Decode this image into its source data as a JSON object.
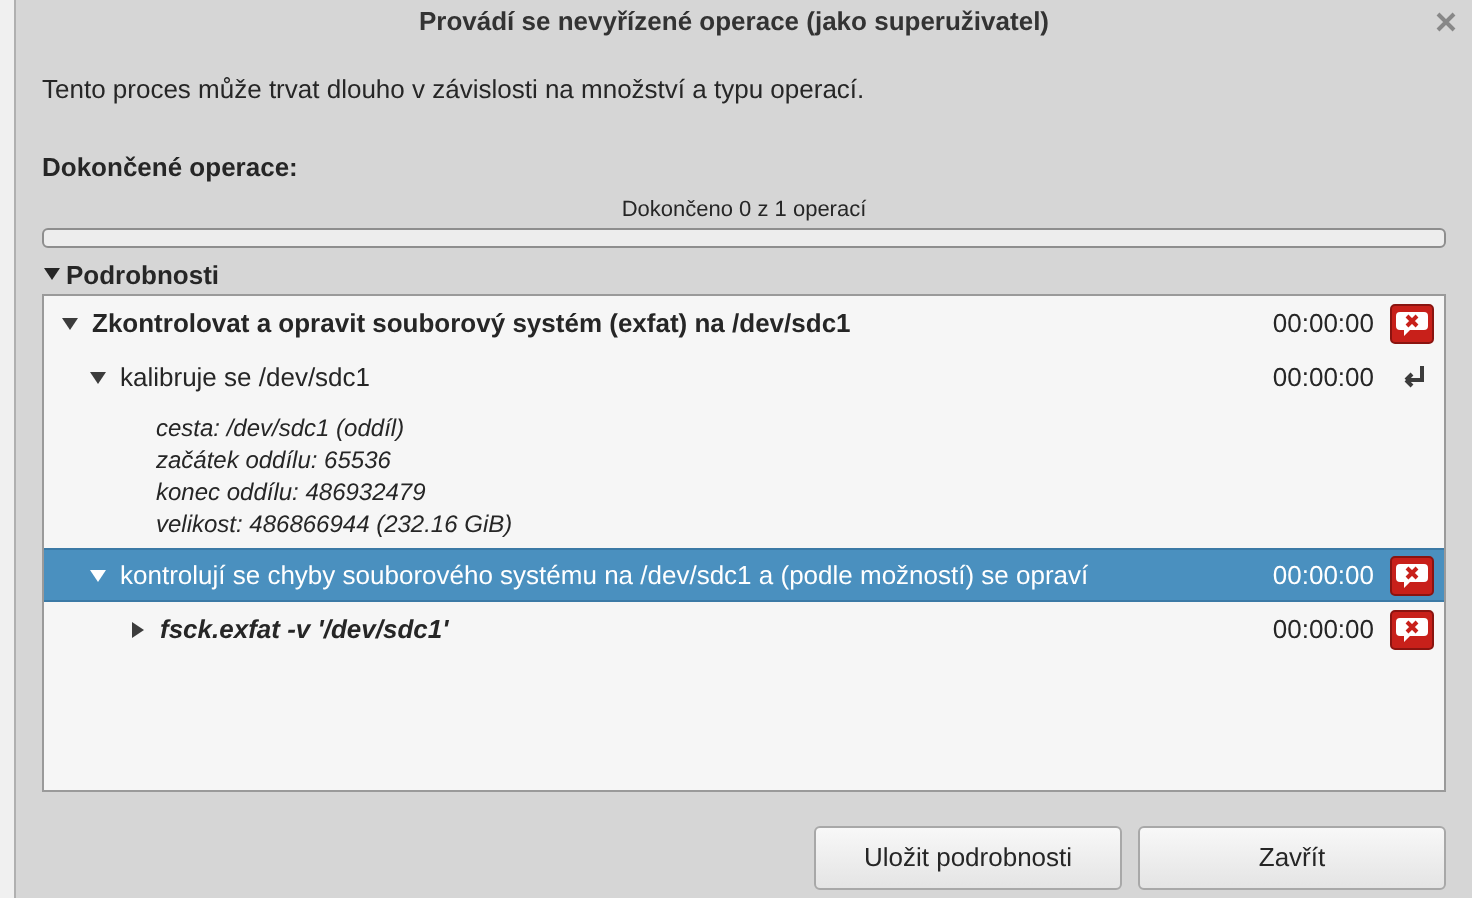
{
  "window": {
    "title": "Provádí se nevyřízené operace (jako superuživatel)"
  },
  "intro": "Tento proces může trvat dlouho v závislosti na množství a typu operací.",
  "progress": {
    "heading": "Dokončené operace:",
    "label": "Dokončeno 0 z 1 operací",
    "level": 0
  },
  "details": {
    "label": "Podrobnosti",
    "expanded": true
  },
  "operations": [
    {
      "kind": "operation",
      "text": "Zkontrolovat a opravit souborový systém (exfat) na /dev/sdc1",
      "time": "00:00:00",
      "icon": {
        "kind": "error"
      },
      "expanded": true,
      "selected": false,
      "children": [
        {
          "kind": "suboperation",
          "text": "kalibruje se /dev/sdc1",
          "time": "00:00:00",
          "icon": {
            "kind": "done"
          },
          "expanded": true,
          "selected": false,
          "info": [
            "cesta: /dev/sdc1 (oddíl)",
            "začátek oddílu: 65536",
            "konec oddílu: 486932479",
            "velikost: 486866944 (232.16 GiB)"
          ]
        },
        {
          "kind": "suboperation",
          "text": "kontrolují se chyby souborového systému na /dev/sdc1 a (podle možností) se opraví",
          "time": "00:00:00",
          "icon": {
            "kind": "error"
          },
          "expanded": true,
          "selected": true,
          "children": [
            {
              "kind": "command",
              "text": "fsck.exfat -v '/dev/sdc1'",
              "time": "00:00:00",
              "icon": {
                "kind": "error"
              },
              "expanded": false,
              "selected": false
            }
          ]
        }
      ]
    }
  ],
  "buttons": [
    "Uložit podrobnosti",
    "Zavřít"
  ]
}
